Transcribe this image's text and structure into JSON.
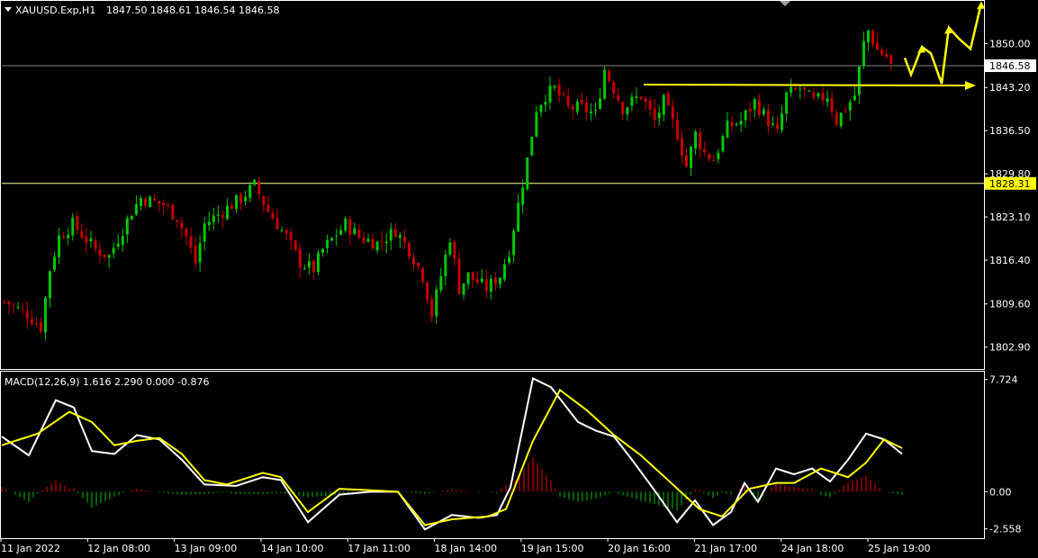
{
  "chart_data": [
    {
      "type": "candlestick",
      "title": "XAUUSD.Exp,H1",
      "ohlc_header": "1847.50 1848.61 1846.54 1846.58",
      "ylim": [
        1799.5,
        1856.5
      ],
      "y_ticks": [
        "1850.00",
        "1843.20",
        "1836.50",
        "1829.80",
        "1823.10",
        "1816.40",
        "1809.60",
        "1802.90"
      ],
      "current_price_label": "1846.58",
      "current_price": 1846.58,
      "support_level_label": "1828.31",
      "support_level": 1828.31,
      "resistance_line_price": 1843.5,
      "x_tick_labels": [
        "11 Jan 2022",
        "12 Jan 08:00",
        "13 Jan 09:00",
        "14 Jan 10:00",
        "17 Jan 11:00",
        "18 Jan 14:00",
        "19 Jan 15:00",
        "20 Jan 16:00",
        "21 Jan 17:00",
        "24 Jan 18:00",
        "25 Jan 19:00"
      ],
      "candle_count": 196,
      "close_path_anchors": [
        [
          0,
          1810
        ],
        [
          5,
          1808
        ],
        [
          8,
          1806
        ],
        [
          10,
          1815
        ],
        [
          12,
          1820
        ],
        [
          15,
          1822
        ],
        [
          20,
          1818
        ],
        [
          23,
          1817
        ],
        [
          28,
          1824
        ],
        [
          30,
          1826
        ],
        [
          35,
          1825
        ],
        [
          38,
          1823
        ],
        [
          40,
          1820
        ],
        [
          42,
          1816
        ],
        [
          44,
          1822
        ],
        [
          48,
          1824
        ],
        [
          52,
          1826
        ],
        [
          55,
          1828
        ],
        [
          58,
          1824
        ],
        [
          62,
          1820
        ],
        [
          65,
          1816
        ],
        [
          68,
          1815
        ],
        [
          70,
          1818
        ],
        [
          75,
          1822
        ],
        [
          78,
          1820
        ],
        [
          82,
          1819
        ],
        [
          86,
          1821
        ],
        [
          89,
          1818
        ],
        [
          92,
          1814
        ],
        [
          94,
          1808
        ],
        [
          96,
          1814
        ],
        [
          98,
          1820
        ],
        [
          100,
          1812
        ],
        [
          102,
          1814
        ],
        [
          106,
          1812
        ],
        [
          109,
          1814
        ],
        [
          111,
          1818
        ],
        [
          113,
          1825
        ],
        [
          115,
          1832
        ],
        [
          117,
          1840
        ],
        [
          119,
          1842
        ],
        [
          121,
          1843
        ],
        [
          124,
          1840
        ],
        [
          127,
          1840
        ],
        [
          130,
          1839
        ],
        [
          132,
          1846
        ],
        [
          134,
          1843
        ],
        [
          136,
          1840
        ],
        [
          140,
          1842
        ],
        [
          143,
          1838
        ],
        [
          145,
          1841
        ],
        [
          148,
          1836
        ],
        [
          150,
          1831
        ],
        [
          152,
          1836
        ],
        [
          154,
          1833
        ],
        [
          156,
          1832
        ],
        [
          159,
          1837
        ],
        [
          162,
          1838
        ],
        [
          165,
          1841
        ],
        [
          168,
          1838
        ],
        [
          170,
          1836
        ],
        [
          172,
          1842
        ],
        [
          175,
          1843
        ],
        [
          178,
          1841
        ],
        [
          181,
          1842
        ],
        [
          183,
          1838
        ],
        [
          185,
          1840
        ],
        [
          187,
          1842
        ],
        [
          189,
          1850
        ],
        [
          190,
          1852
        ],
        [
          192,
          1849
        ],
        [
          194,
          1848
        ],
        [
          195,
          1846.58
        ]
      ],
      "projection_arrows": "yellow zigzag projected path upward",
      "horizontal_lines": [
        {
          "price": 1846.58,
          "color": "#808080"
        },
        {
          "price": 1828.31,
          "color": "#ffff99"
        }
      ],
      "colors": {
        "bull": "#00c800",
        "bear": "#c80000",
        "projection": "#ffff00",
        "grid_text": "#ffffff"
      }
    },
    {
      "type": "line",
      "title": "MACD(12,26,9) 1.616 2.290 0.000 -0.876",
      "ylim": [
        -3.2,
        8.2
      ],
      "y_ticks": [
        "7.724",
        "0.00",
        "-2.558"
      ],
      "series": [
        {
          "name": "MACD",
          "color": "#ffffff",
          "anchors": [
            [
              0,
              3.8
            ],
            [
              6,
              2.5
            ],
            [
              12,
              6.3
            ],
            [
              16,
              5.8
            ],
            [
              20,
              2.8
            ],
            [
              25,
              2.6
            ],
            [
              30,
              3.9
            ],
            [
              35,
              3.6
            ],
            [
              40,
              2.2
            ],
            [
              45,
              0.5
            ],
            [
              52,
              0.4
            ],
            [
              58,
              1.0
            ],
            [
              62,
              0.8
            ],
            [
              68,
              -2.1
            ],
            [
              75,
              -0.2
            ],
            [
              82,
              0.0
            ],
            [
              88,
              0.0
            ],
            [
              94,
              -2.6
            ],
            [
              100,
              -1.6
            ],
            [
              106,
              -1.8
            ],
            [
              110,
              -1.6
            ],
            [
              113,
              0.3
            ],
            [
              118,
              7.8
            ],
            [
              122,
              7.2
            ],
            [
              128,
              4.8
            ],
            [
              132,
              4.2
            ],
            [
              136,
              3.8
            ],
            [
              140,
              2.2
            ],
            [
              145,
              0.1
            ],
            [
              150,
              -2.1
            ],
            [
              154,
              -0.6
            ],
            [
              158,
              -2.3
            ],
            [
              162,
              -1.4
            ],
            [
              165,
              0.6
            ],
            [
              168,
              -0.7
            ],
            [
              172,
              1.6
            ],
            [
              176,
              1.2
            ],
            [
              180,
              1.6
            ],
            [
              184,
              0.7
            ],
            [
              188,
              2.2
            ],
            [
              192,
              4.0
            ],
            [
              196,
              3.6
            ],
            [
              200,
              2.6
            ]
          ]
        },
        {
          "name": "Signal",
          "color": "#ffff00",
          "anchors": [
            [
              0,
              3.2
            ],
            [
              8,
              4.0
            ],
            [
              15,
              5.5
            ],
            [
              20,
              4.8
            ],
            [
              25,
              3.2
            ],
            [
              30,
              3.5
            ],
            [
              35,
              3.7
            ],
            [
              40,
              2.6
            ],
            [
              45,
              0.8
            ],
            [
              50,
              0.5
            ],
            [
              58,
              1.3
            ],
            [
              62,
              1.0
            ],
            [
              68,
              -1.4
            ],
            [
              75,
              0.2
            ],
            [
              82,
              0.1
            ],
            [
              88,
              0.0
            ],
            [
              94,
              -2.3
            ],
            [
              100,
              -1.9
            ],
            [
              108,
              -1.7
            ],
            [
              112,
              -1.2
            ],
            [
              118,
              3.5
            ],
            [
              124,
              7.0
            ],
            [
              130,
              5.6
            ],
            [
              136,
              3.9
            ],
            [
              142,
              2.5
            ],
            [
              148,
              0.8
            ],
            [
              155,
              -1.2
            ],
            [
              160,
              -1.7
            ],
            [
              166,
              0.2
            ],
            [
              172,
              0.6
            ],
            [
              176,
              0.6
            ],
            [
              182,
              1.6
            ],
            [
              188,
              1.0
            ],
            [
              192,
              2.0
            ],
            [
              196,
              3.6
            ],
            [
              200,
              3.0
            ]
          ]
        }
      ],
      "histogram": [
        {
          "name": "histogram-positive",
          "color": "#c80000"
        },
        {
          "name": "histogram-negative",
          "color": "#00a000"
        }
      ]
    }
  ]
}
